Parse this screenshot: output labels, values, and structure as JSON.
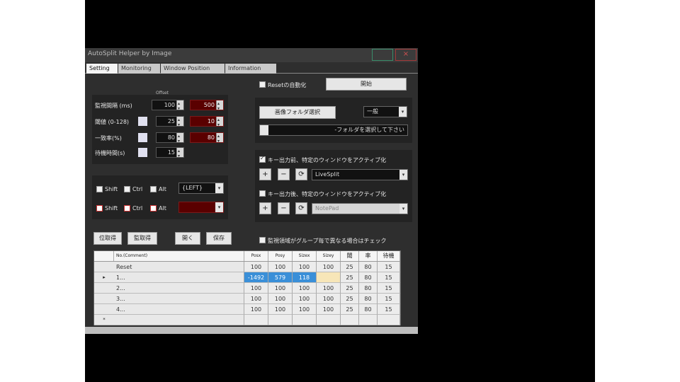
{
  "window": {
    "title": "AutoSplit Helper by Image"
  },
  "tabs": [
    "Setting",
    "Monitoring",
    "Window Position",
    "Information"
  ],
  "settings": {
    "small_header": "Offset",
    "rows": [
      {
        "label": "監視間隔 (ms)",
        "v1": "100",
        "v2": "500"
      },
      {
        "label": "閾値 (0-128)",
        "v1": "25",
        "v2": "10"
      },
      {
        "label": "一致率(%)",
        "v1": "80",
        "v2": "80"
      },
      {
        "label": "待機時間(s)",
        "v1": "15"
      }
    ]
  },
  "hotkeys": {
    "shift": "Shift",
    "ctrl": "Ctrl",
    "alt": "Alt",
    "key1": "{LEFT}",
    "key2": ""
  },
  "buttons": {
    "start_reset": "開始",
    "reset_auto": "Resetの自動化",
    "folder": "画像フォルダ選択",
    "folder_mode": "一般",
    "folder_path": "-フォルダを選択して下さい",
    "activate_before": "キー出力前、特定のウィンドウをアクティブ化",
    "activate_after": "キー出力後、特定のウィンドウをアクティブ化",
    "window1": "LiveSplit",
    "window2": "NotePad",
    "plus": "+",
    "minus": "−",
    "reload": "⟳",
    "b1": "位取得",
    "b2": "監取得",
    "open": "開く",
    "save": "保存",
    "monitor_check": "監視領域がグループ毎で異なる場合はチェック"
  },
  "grid": {
    "headers": [
      "No.(Comment)",
      "Posx",
      "Posy",
      "Sizex",
      "Sizey",
      "閾",
      "率",
      "待機"
    ],
    "rows": [
      {
        "marker": "",
        "name": "Reset",
        "cells": [
          "100",
          "100",
          "100",
          "100",
          "25",
          "80",
          "15"
        ]
      },
      {
        "marker": "▸",
        "name": "1...",
        "cells": [
          "-1492",
          "579",
          "118",
          "",
          "25",
          "80",
          "15"
        ]
      },
      {
        "marker": "",
        "name": "2...",
        "cells": [
          "100",
          "100",
          "100",
          "100",
          "25",
          "80",
          "15"
        ]
      },
      {
        "marker": "",
        "name": "3...",
        "cells": [
          "100",
          "100",
          "100",
          "100",
          "25",
          "80",
          "15"
        ]
      },
      {
        "marker": "",
        "name": "4...",
        "cells": [
          "100",
          "100",
          "100",
          "100",
          "25",
          "80",
          "15"
        ]
      },
      {
        "marker": "*",
        "name": "",
        "cells": [
          "",
          "",
          "",
          "",
          "",
          "",
          ""
        ]
      }
    ]
  }
}
